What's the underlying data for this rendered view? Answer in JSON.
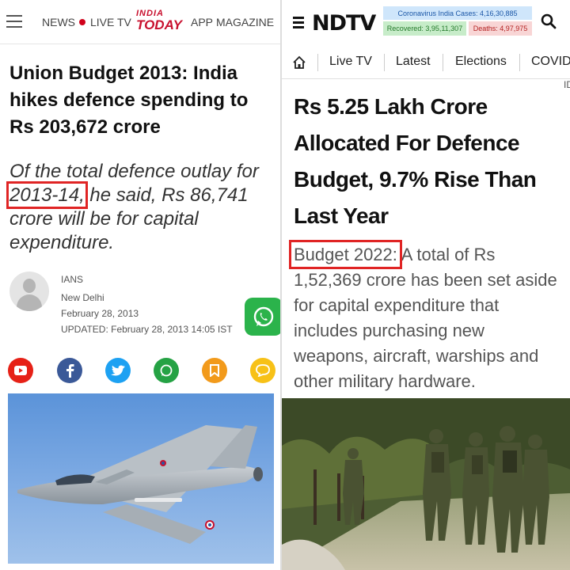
{
  "left": {
    "header": {
      "nav_news": "NEWS",
      "nav_live": "LIVE TV",
      "logo_line1": "INDIA",
      "logo_line2": "TODAY",
      "nav_app": "APP",
      "nav_magazine": "MAGAZINE"
    },
    "article": {
      "title": "Union Budget 2013: India hikes defence spending to Rs 203,672 crore",
      "sub_prefix": "Of the total defence outlay for ",
      "sub_highlight": "2013-14,",
      "sub_suffix": " he said, Rs 86,741 crore will be for capital expenditure.",
      "author": "IANS",
      "location": "New Delhi",
      "date": "February 28, 2013",
      "updated": "UPDATED: February 28, 2013 14:05 IST"
    },
    "share_icons": [
      "youtube-icon",
      "facebook-icon",
      "twitter-icon",
      "whatsapp-icon",
      "bookmark-icon",
      "comment-icon"
    ],
    "colors": {
      "brand": "#c8102e",
      "highlight": "#e02424",
      "whatsapp": "#2bb34b"
    }
  },
  "right": {
    "header": {
      "logo": "NDTV",
      "covid_cases": "Coronavirus India Cases: 4,16,30,885",
      "covid_recovered": "Recovered: 3,95,11,307",
      "covid_deaths": "Deaths: 4,97,975"
    },
    "nav": {
      "items": [
        "Live TV",
        "Latest",
        "Elections",
        "COVID"
      ],
      "edge_text": "ID"
    },
    "article": {
      "title": "Rs 5.25 Lakh Crore Allocated For Defence Budget, 9.7% Rise Than Last Year",
      "sub_highlight": "Budget 2022:",
      "sub_suffix": " A total of Rs 1,52,369 crore has been set aside for capital expenditure that includes purchasing new weapons, aircraft, warships and other military hardware."
    }
  }
}
